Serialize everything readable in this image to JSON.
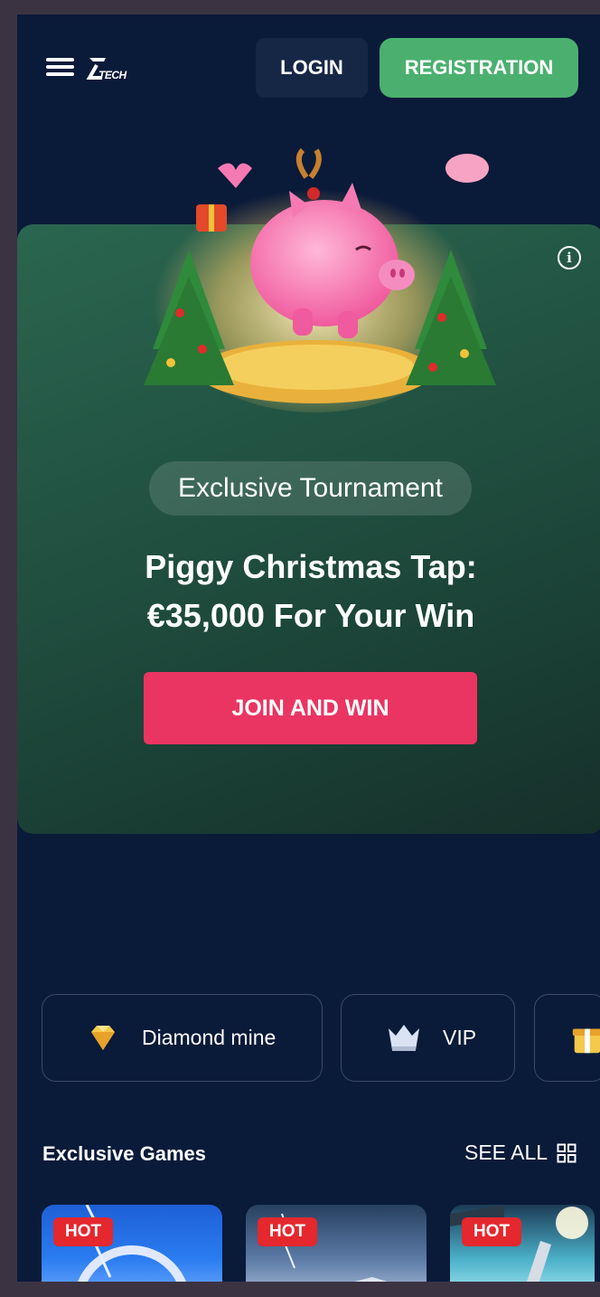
{
  "header": {
    "logo_text": "TECH",
    "login_label": "LOGIN",
    "registration_label": "REGISTRATION"
  },
  "promo": {
    "badge": "Exclusive Tournament",
    "title_line1": "Piggy Christmas Tap:",
    "title_line2": "€35,000 For Your Win",
    "cta_label": "JOIN AND WIN",
    "info_glyph": "i"
  },
  "chips": [
    {
      "label": "Diamond mine",
      "icon": "diamond-icon"
    },
    {
      "label": "VIP",
      "icon": "crown-icon"
    },
    {
      "label": "",
      "icon": "gift-icon"
    }
  ],
  "section": {
    "title": "Exclusive Games",
    "see_all": "SEE ALL"
  },
  "games": [
    {
      "badge": "HOT"
    },
    {
      "badge": "HOT"
    },
    {
      "badge": "HOT"
    }
  ],
  "colors": {
    "background": "#0a1a39",
    "registration": "#4bb06f",
    "cta": "#ea3562",
    "hot_badge": "#e5272e",
    "promo_card": "#1e4a3c"
  }
}
